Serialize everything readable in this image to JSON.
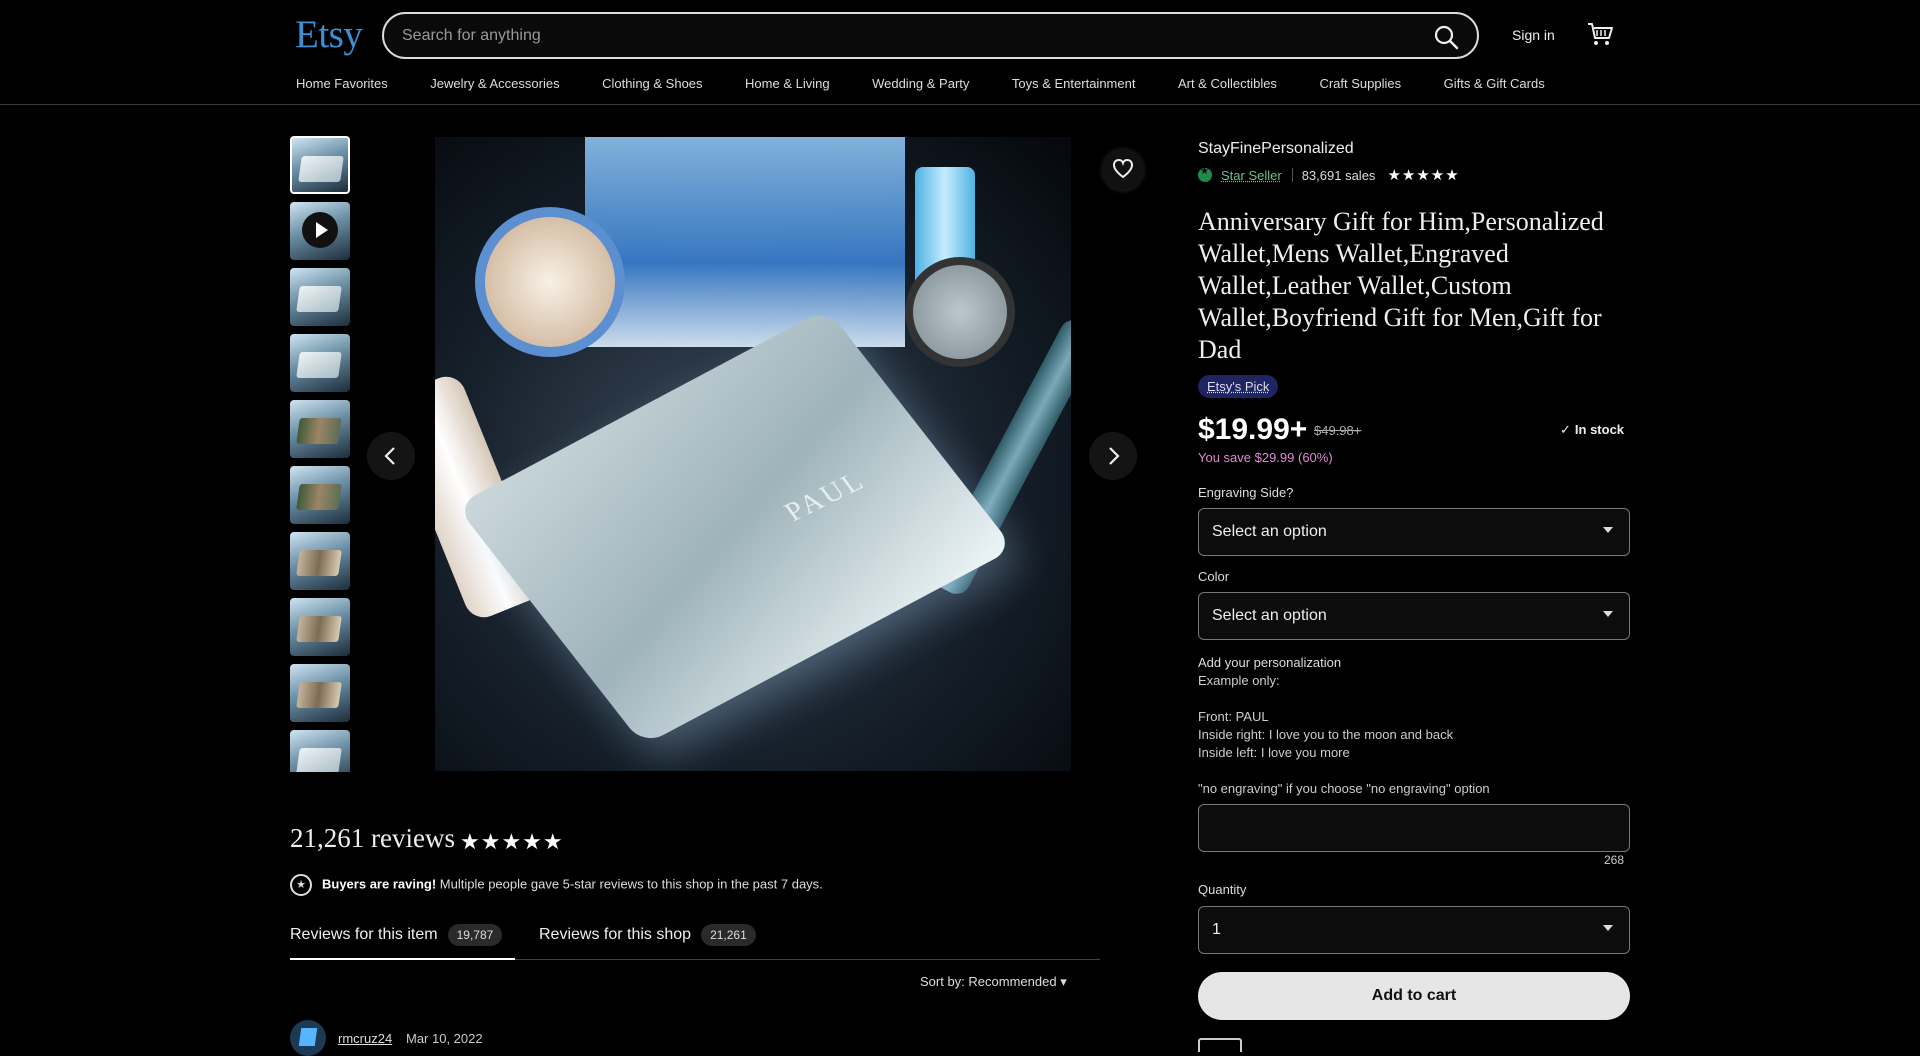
{
  "header": {
    "logo": "Etsy",
    "search_placeholder": "Search for anything",
    "sign_in": "Sign in",
    "categories": [
      "Home Favorites",
      "Jewelry & Accessories",
      "Clothing & Shoes",
      "Home & Living",
      "Wedding & Party",
      "Toys & Entertainment",
      "Art & Collectibles",
      "Craft Supplies",
      "Gifts & Gift Cards"
    ]
  },
  "gallery": {
    "thumbnail_count": 10,
    "main_image_text": "PAUL"
  },
  "listing": {
    "shop_name": "StayFinePersonalized",
    "star_seller": "Star Seller",
    "sales": "83,691 sales",
    "shop_rating_stars": 5,
    "title": "Anniversary Gift for Him,Personalized Wallet,Mens Wallet,Engraved Wallet,Leather Wallet,Custom Wallet,Boyfriend Gift for Men,Gift for Dad",
    "badge": "Etsy's Pick",
    "price": "$19.99+",
    "original_price": "$49.98+",
    "stock": "In stock",
    "savings": "You save $29.99 (60%)",
    "engraving_label": "Engraving Side?",
    "engraving_value": "Select an option",
    "color_label": "Color",
    "color_value": "Select an option",
    "personalization_title": "Add your personalization",
    "personalization_example": "Example only:\n\nFront: PAUL\nInside right: I love you to the moon and back\nInside left: I love you more\n\n\"no engraving\" if you choose \"no engraving\" option",
    "char_count": "268",
    "quantity_label": "Quantity",
    "quantity_value": "1",
    "add_to_cart": "Add to cart"
  },
  "reviews": {
    "title": "21,261 reviews",
    "rating_stars": 5,
    "raving_bold": "Buyers are raving!",
    "raving_text": "Multiple people gave 5-star reviews to this shop in the past 7 days.",
    "tab_item": "Reviews for this item",
    "tab_item_count": "19,787",
    "tab_shop": "Reviews for this shop",
    "tab_shop_count": "21,261",
    "sort": "Sort by: Recommended",
    "first_review_user": "rmcruz24",
    "first_review_date": "Mar 10, 2022"
  },
  "colors": {
    "brand": "#3b8fd4",
    "savings": "#e08ad6",
    "star_seller": "#6cc28b"
  }
}
